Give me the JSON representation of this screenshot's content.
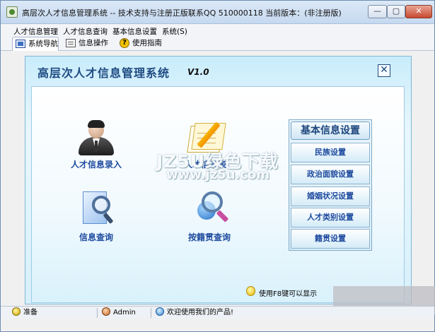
{
  "titlebar": {
    "title": "高层次人才信息管理系统 -- 技术支持与注册正版联系QQ 510000118   当前版本：(非注册版)",
    "min_label": "—",
    "max_label": "▢",
    "close_label": "✕"
  },
  "menu": {
    "items": [
      "人才信息管理",
      "人才信息查询",
      "基本信息设置",
      "系统(S)"
    ]
  },
  "toolbar": {
    "tabs": [
      "系统导航",
      "信息操作",
      "使用指南"
    ],
    "help_glyph": "?"
  },
  "main": {
    "title": "高层次人才信息管理系统",
    "version": "V1.0",
    "close_label": "✕",
    "functions": [
      "人才信息录入",
      "人才信息表",
      "信息查询",
      "按籍贯查询"
    ]
  },
  "basic_settings": {
    "header": "基本信息设置",
    "buttons": [
      "民族设置",
      "政治面貌设置",
      "婚姻状况设置",
      "人才类别设置",
      "籍贯设置"
    ]
  },
  "hint": "使用F8键可以显示",
  "watermark": {
    "top": "JZ5U绿色下载",
    "bottom": "www.jz5u.com"
  },
  "status": {
    "ready": "准备",
    "user": "Admin",
    "welcome": "欢迎使用我们的产品!"
  },
  "colors": {
    "accent_blue": "#1f4b9f",
    "title_blue": "#1f4b82",
    "panel_bg": "#c9ecfb"
  }
}
